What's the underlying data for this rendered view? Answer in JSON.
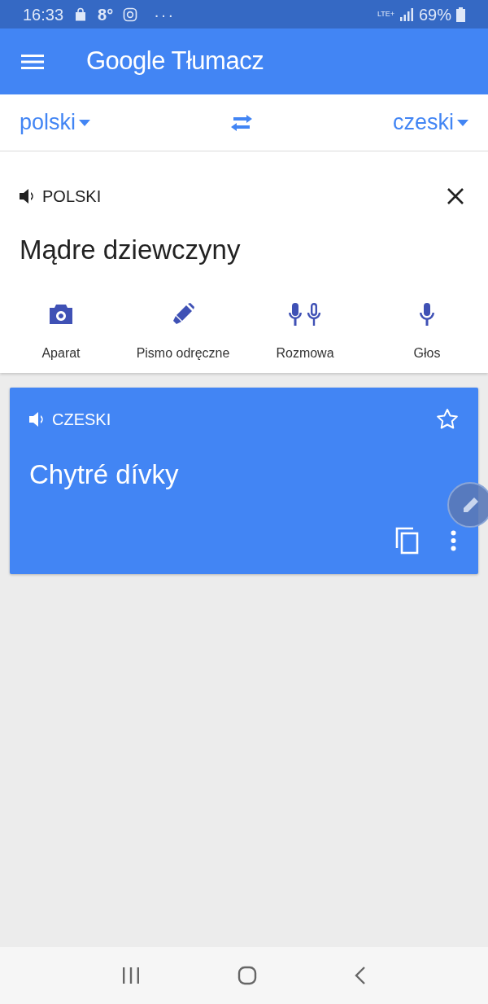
{
  "status_bar": {
    "time": "16:33",
    "temperature": "8°",
    "more": "···",
    "network": "LTE+",
    "battery": "69%"
  },
  "app_bar": {
    "title": "Google Tłumacz"
  },
  "languages": {
    "source": "polski",
    "target": "czeski"
  },
  "input": {
    "language_label": "POLSKI",
    "text": "Mądre dziewczyny"
  },
  "tools": [
    {
      "kind": "camera",
      "label": "Aparat"
    },
    {
      "kind": "handwriting",
      "label": "Pismo odręczne"
    },
    {
      "kind": "conversation",
      "label": "Rozmowa"
    },
    {
      "kind": "voice",
      "label": "Głos"
    }
  ],
  "result": {
    "language_label": "CZESKI",
    "text": "Chytré dívky",
    "starred": false
  }
}
